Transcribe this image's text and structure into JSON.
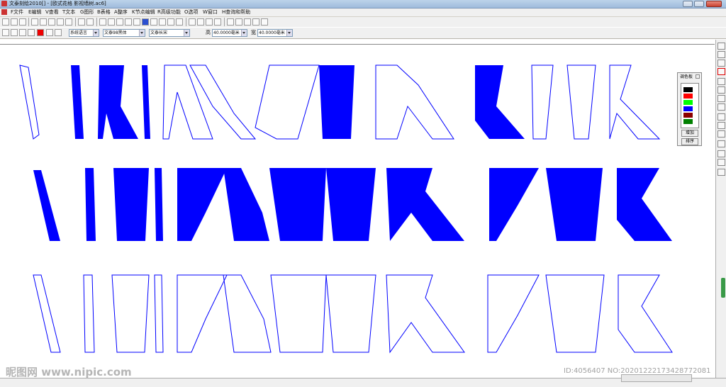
{
  "window": {
    "title": "文泰刻绘2010[] - [欧式花格  影视墙树.ac6]"
  },
  "menu": [
    "F文件",
    "E编辑",
    "V查看",
    "T文本",
    "G图形",
    "B表格",
    "A整序",
    "K节点编辑",
    "R高级功能",
    "O选项",
    "W窗口",
    "H查询和帮助"
  ],
  "toolbar2": {
    "font_lang": "系统语言",
    "font_name": "文泰98黑体",
    "font_style": "文泰长宋",
    "height_label": "高",
    "height_value": "40.0000毫米",
    "width_label": "宽",
    "width_value": "40.0000毫米"
  },
  "palette": {
    "title": "调色板",
    "colors": [
      "#000000",
      "#ff0000",
      "#00ff00",
      "#0000ff",
      "#8b0000",
      "#008000"
    ],
    "add_label": "增加",
    "sort_label": "排序"
  },
  "colors": {
    "accent": "#0000ff"
  },
  "watermarks": {
    "left": "昵图网 www.nipic.com",
    "right": "ID:4056407 NO:20201222173428772081"
  }
}
